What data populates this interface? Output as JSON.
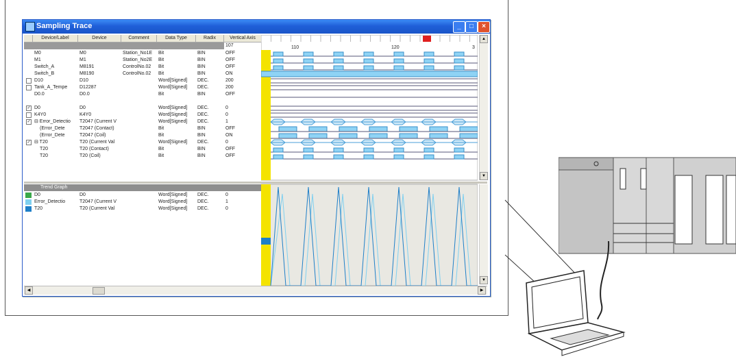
{
  "window": {
    "title": "Sampling Trace",
    "minimize": "_",
    "maximize": "□",
    "close": "×"
  },
  "columns": {
    "label": "Device/Label",
    "device": "Device",
    "comment": "Comment",
    "type": "Data Type",
    "radix": "Radix",
    "vaxis": "Vertical Axis"
  },
  "vaxis_value": "107",
  "ruler": {
    "t1": "110",
    "t2": "120",
    "t3": "3"
  },
  "rows": [
    {
      "label": "M0",
      "device": "M0",
      "comment": "Station_No1E",
      "type": "Bit",
      "radix": "BIN",
      "value": "OFF",
      "check": ""
    },
    {
      "label": "M1",
      "device": "M1",
      "comment": "Station_No2E",
      "type": "Bit",
      "radix": "BIN",
      "value": "OFF",
      "check": ""
    },
    {
      "label": "Switch_A",
      "device": "M8191",
      "comment": "ControlNo.02",
      "type": "Bit",
      "radix": "BIN",
      "value": "OFF",
      "check": ""
    },
    {
      "label": "Switch_B",
      "device": "M8190",
      "comment": "ControlNo.02",
      "type": "Bit",
      "radix": "BIN",
      "value": "ON",
      "check": ""
    },
    {
      "label": "D10",
      "device": "D10",
      "comment": "",
      "type": "Word[Signed]",
      "radix": "DEC.",
      "value": "200",
      "check": " "
    },
    {
      "label": "Tank_A_Tempe",
      "device": "D12287",
      "comment": "",
      "type": "Word[Signed]",
      "radix": "DEC.",
      "value": "200",
      "check": " "
    },
    {
      "label": "D0.0",
      "device": "D0.0",
      "comment": "",
      "type": "Bit",
      "radix": "BIN",
      "value": "OFF",
      "check": ""
    },
    {
      "label": "",
      "device": "",
      "comment": "",
      "type": "",
      "radix": "",
      "value": "",
      "check": ""
    },
    {
      "label": "D0",
      "device": "D0",
      "comment": "",
      "type": "Word[Signed]",
      "radix": "DEC.",
      "value": "0",
      "check": "✓"
    },
    {
      "label": "K4Y0",
      "device": "K4Y0",
      "comment": "",
      "type": "Word[Signed]",
      "radix": "DEC.",
      "value": "0",
      "check": " "
    },
    {
      "label": "⊟ Error_Detectio",
      "device": "T2047 (Current V",
      "comment": "",
      "type": "Word[Signed]",
      "radix": "DEC.",
      "value": "1",
      "check": "✓"
    },
    {
      "label": "(Error_Dete",
      "device": "T2047 (Contact)",
      "comment": "",
      "type": "Bit",
      "radix": "BIN",
      "value": "OFF",
      "check": ""
    },
    {
      "label": "(Error_Dete",
      "device": "T2047 (Coil)",
      "comment": "",
      "type": "Bit",
      "radix": "BIN",
      "value": "ON",
      "check": ""
    },
    {
      "label": "⊟ T20",
      "device": "T20 (Current Val",
      "comment": "",
      "type": "Word[Signed]",
      "radix": "DEC.",
      "value": "0",
      "check": "✓"
    },
    {
      "label": "T20",
      "device": "T20 (Contact)",
      "comment": "",
      "type": "Bit",
      "radix": "BIN",
      "value": "OFF",
      "check": ""
    },
    {
      "label": "T20",
      "device": "T20 (Coil)",
      "comment": "",
      "type": "Bit",
      "radix": "BIN",
      "value": "OFF",
      "check": ""
    }
  ],
  "trend": {
    "header": "Trend Graph",
    "rows": [
      {
        "label": "D0",
        "device": "D0",
        "type": "Word[Signed]",
        "radix": "DEC.",
        "value": "0",
        "color": "#3aa84a"
      },
      {
        "label": "Error_Detectio",
        "device": "T2047 (Current V",
        "type": "Word[Signed]",
        "radix": "DEC.",
        "value": "1",
        "color": "#7fd0f0"
      },
      {
        "label": "T20",
        "device": "T20 (Current Val",
        "type": "Word[Signed]",
        "radix": "DEC.",
        "value": "0",
        "color": "#1e7fc8"
      }
    ]
  },
  "colors": {
    "signal": "#8fd3f5",
    "cursor": "#f4e300",
    "marker": "#e02020",
    "bus": "#4a9fd8"
  }
}
